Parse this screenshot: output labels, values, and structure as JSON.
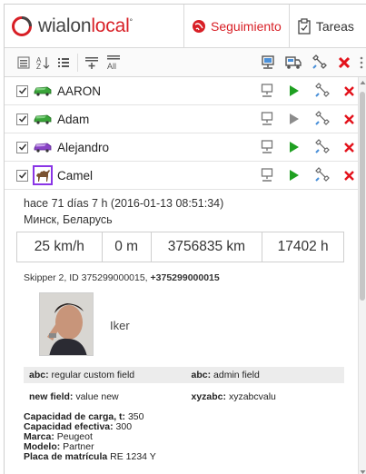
{
  "header": {
    "logo_part1": "wialon",
    "logo_part2": "local",
    "tabs": [
      {
        "label": "Seguimiento",
        "icon": "globe-icon",
        "active": true
      },
      {
        "label": "Tareas",
        "icon": "clipboard-icon",
        "active": false
      }
    ]
  },
  "toolbar": {
    "left_icons": [
      "list-toggle-icon",
      "sort-az-icon",
      "list-icon",
      "group-add-icon",
      "show-all-icon"
    ],
    "sort_label": "AZ",
    "all_label": "All",
    "right_icons": [
      "monitor-icon",
      "truck-icon",
      "wrench-icon",
      "delete-icon",
      "more-icon"
    ]
  },
  "units": [
    {
      "name": "AARON",
      "icon": "car-green-icon",
      "play_color": "#1fa021"
    },
    {
      "name": "Adam",
      "icon": "car-green-icon",
      "play_color": "#8c8c8c"
    },
    {
      "name": "Alejandro",
      "icon": "car-purple-icon",
      "play_color": "#1fa021"
    },
    {
      "name": "Camel",
      "icon": "camel-icon",
      "play_color": "#1fa021"
    }
  ],
  "detail": {
    "time": "hace 71 días 7 h (2016-01-13 08:51:34)",
    "place": "Минск, Беларусь",
    "stats": [
      "25 km/h",
      "0 m",
      "3756835 km",
      "17402 h"
    ],
    "device_prefix": "Skipper 2, ID 375299000015, ",
    "device_phone": "+375299000015",
    "driver_name": "Iker",
    "custom_fields": [
      {
        "key1": "abc:",
        "val1": "regular custom field",
        "key2": "abc:",
        "val2": "admin field"
      },
      {
        "key1": "new field:",
        "val1": "value new",
        "key2": "xyzabc:",
        "val2": "xyzabcvalu"
      }
    ],
    "properties": [
      {
        "key": "Capacidad de carga, t:",
        "val": "350"
      },
      {
        "key": "Capacidad efectiva:",
        "val": "300"
      },
      {
        "key": "Marca:",
        "val": "Peugeot"
      },
      {
        "key": "Modelo:",
        "val": "Partner"
      },
      {
        "key": "Placa de matrícula",
        "val": "RE 1234 Y"
      }
    ]
  },
  "colors": {
    "brand_red": "#d81f26",
    "selection_purple": "#8a35e6",
    "play_green": "#1fa021"
  }
}
